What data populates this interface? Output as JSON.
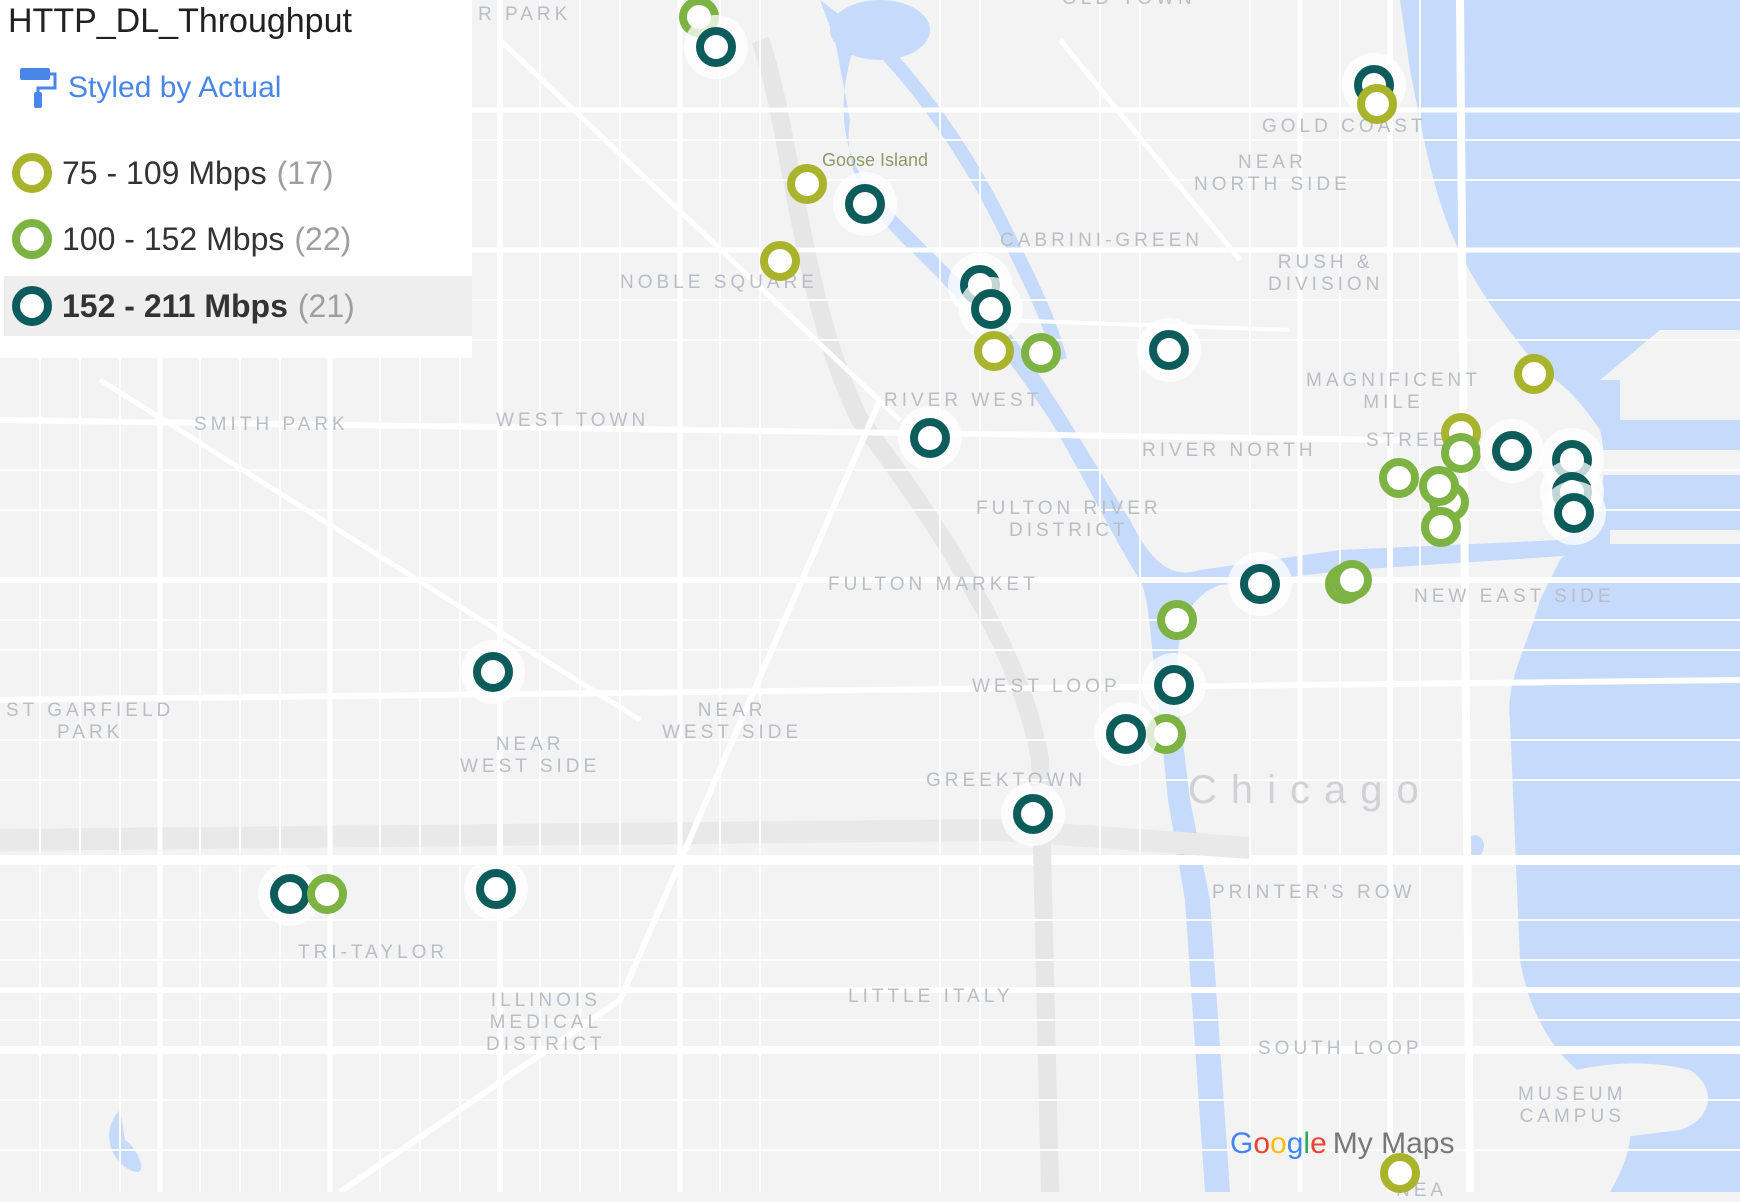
{
  "legend": {
    "title": "HTTP_DL_Throughput",
    "styled_by": "Styled by Actual",
    "items": [
      {
        "label": "75 - 109 Mbps",
        "count": "(17)",
        "color": "#aab32c",
        "selected": false
      },
      {
        "label": "100 - 152 Mbps",
        "count": "(22)",
        "color": "#7cb342",
        "selected": false
      },
      {
        "label": "152 - 211 Mbps",
        "count": "(21)",
        "color": "#0b5c5a",
        "selected": true
      }
    ]
  },
  "map": {
    "city_label": "Chicago",
    "poi_labels": [
      "Goose Island"
    ],
    "area_labels": [
      "R PARK",
      "OLD TOWN",
      "GOLD COAST",
      "NEAR\nNORTH SIDE",
      "CABRINI-GREEN",
      "RUSH &\nDIVISION",
      "NOBLE SQUARE",
      "MAGNIFICENT\nMILE",
      "RIVER WEST",
      "SMITH PARK",
      "WEST TOWN",
      "RIVER NORTH",
      "STREETERVILLE",
      "FULTON RIVER\nDISTRICT",
      "FULTON MARKET",
      "NEW EAST SIDE",
      "WEST LOOP",
      "ST GARFIELD\nPARK",
      "NEAR\nWEST SIDE",
      "NEAR\nWEST SIDE",
      "GREEKTOWN",
      "PRINTER'S ROW",
      "TRI-TAYLOR",
      "ILLINOIS\nMEDICAL\nDISTRICT",
      "LITTLE ITALY",
      "SOUTH LOOP",
      "MUSEUM\nCAMPUS",
      "NEA"
    ],
    "colors": {
      "land": "#f3f3f3",
      "road": "#ffffff",
      "water": "#c6dafc",
      "label": "#b9bdc6"
    },
    "markers": [
      {
        "category": 1
      },
      {
        "category": 2
      },
      {
        "category": 2
      },
      {
        "category": 0
      },
      {
        "category": 0
      },
      {
        "category": 2
      },
      {
        "category": 0
      },
      {
        "category": 2
      },
      {
        "category": 2
      },
      {
        "category": 0
      },
      {
        "category": 1
      },
      {
        "category": 2
      },
      {
        "category": 2
      },
      {
        "category": 0
      },
      {
        "category": 0
      },
      {
        "category": 1
      },
      {
        "category": 2
      },
      {
        "category": 2
      },
      {
        "category": 2
      },
      {
        "category": 2
      },
      {
        "category": 1
      },
      {
        "category": 1
      },
      {
        "category": 1
      },
      {
        "category": 1
      },
      {
        "category": 2
      },
      {
        "category": 1
      },
      {
        "category": 1
      },
      {
        "category": 1
      },
      {
        "category": 2
      },
      {
        "category": 1
      },
      {
        "category": 2
      },
      {
        "category": 2
      },
      {
        "category": 2
      },
      {
        "category": 2
      },
      {
        "category": 1
      },
      {
        "category": 2
      },
      {
        "category": 0
      }
    ]
  },
  "watermark": {
    "brand_letters": [
      "G",
      "o",
      "o",
      "g",
      "l",
      "e"
    ],
    "product": "My Maps"
  }
}
